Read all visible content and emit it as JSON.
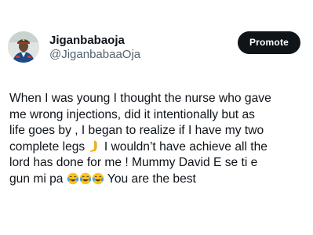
{
  "header": {
    "display_name": "Jiganbabaoja",
    "handle": "@JiganbabaaOja",
    "promote_label": "Promote"
  },
  "tweet": {
    "line1": "When I was young I  thought the nurse who gave",
    "line2": "me wrong injections, did it intentionally but as",
    "line3": "life goes by  , I began to realize if I have my two",
    "line4a": "complete legs ",
    "line4b": " I wouldn’t have achieve all the",
    "line5": "lord has done for me ! Mummy David E se ti e",
    "line6a": "gun mi pa ",
    "line6b": " You are the best"
  },
  "icons": {
    "avatar": "profile-photo",
    "leg_emoji": "leg-emoji",
    "laugh_emoji": "face-with-tears-of-joy-emoji"
  },
  "colors": {
    "text": "#0f1419",
    "secondary": "#536471",
    "button_bg": "#0f1419",
    "button_text": "#ffffff"
  }
}
